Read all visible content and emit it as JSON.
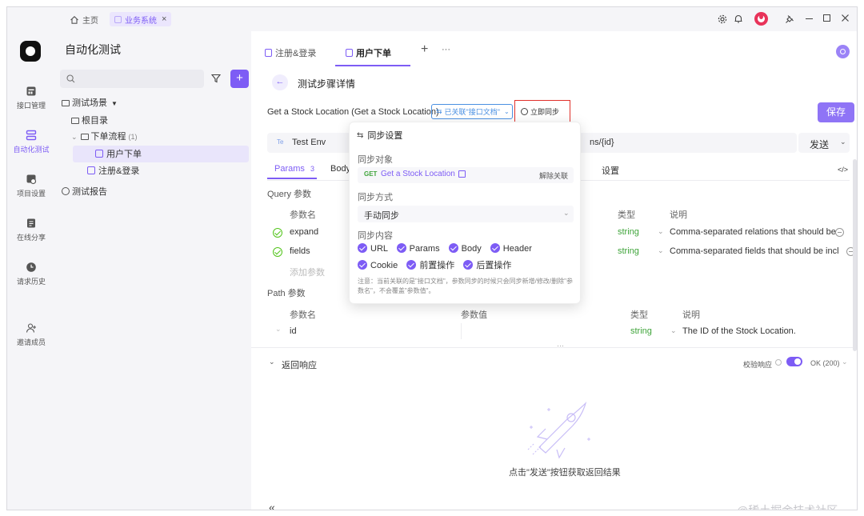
{
  "titlebar": {
    "home_tab": "主页",
    "biz_tab": "业务系统",
    "close": "×"
  },
  "rail": {
    "items": [
      {
        "label": "接口管理",
        "icon": "api-icon"
      },
      {
        "label": "自动化测试",
        "icon": "automation-icon",
        "active": true
      },
      {
        "label": "项目设置",
        "icon": "settings-icon"
      },
      {
        "label": "在线分享",
        "icon": "share-icon"
      },
      {
        "label": "请求历史",
        "icon": "history-icon"
      },
      {
        "label": "邀请成员",
        "icon": "invite-icon"
      }
    ]
  },
  "tree": {
    "title": "自动化测试",
    "search_placeholder": "",
    "add": "+",
    "scenes": "测试场景",
    "root_dir": "根目录",
    "folder": "下单流程",
    "folder_count": "(1)",
    "case_order": "用户下单",
    "case_login": "注册&登录",
    "report": "测试报告"
  },
  "tabs": {
    "tab1": "注册&登录",
    "tab2": "用户下单",
    "add": "+",
    "more": "···"
  },
  "detail": {
    "back": "←",
    "title": "测试步骤详情",
    "api_name": "Get a Stock Location (Get a Stock Location)",
    "linked_label": "已关联\"接口文档\"",
    "sync_now": "立即同步",
    "save": "保存",
    "env_badge": "Te",
    "env": "Test Env",
    "url_tail": "ns/{id}",
    "send": "发送"
  },
  "req_tabs": {
    "params": "Params",
    "params_count": "3",
    "body": "Body",
    "settings": "设置",
    "code": "</>"
  },
  "query": {
    "section": "Query 参数",
    "col_name": "参数名",
    "col_type": "类型",
    "col_desc": "说明",
    "rows": [
      {
        "name": "expand",
        "type": "string",
        "desc": "Comma-separated relations that should be"
      },
      {
        "name": "fields",
        "type": "string",
        "desc": "Comma-separated fields that should be incl"
      }
    ],
    "add_param": "添加参数"
  },
  "path": {
    "section": "Path 参数",
    "col_name": "参数名",
    "col_value": "参数值",
    "col_type": "类型",
    "col_desc": "说明",
    "rows": [
      {
        "name": "id",
        "type": "string",
        "desc": "The ID of the Stock Location."
      }
    ]
  },
  "response": {
    "title": "返回响应",
    "verify": "校验响应",
    "status": "OK (200)",
    "empty_hint": "点击\"发送\"按钮获取返回结果",
    "collapse": "«",
    "footer": "@稀土掘金技术社区"
  },
  "popup": {
    "title": "同步设置",
    "target_label": "同步对象",
    "method": "GET",
    "target": "Get a Stock Location",
    "unlink": "解除关联",
    "mode_label": "同步方式",
    "mode": "手动同步",
    "content_label": "同步内容",
    "options": [
      "URL",
      "Params",
      "Body",
      "Header",
      "Cookie",
      "前置操作",
      "后置操作"
    ],
    "note": "注意：当前关联的是\"接口文档\"，参数同步的时候只会同步新增/修改/删除\"参数名\"，不会覆盖\"参数值\"。"
  },
  "colors": {
    "accent": "#7d5cf5",
    "sidebar_bg": "#f5f5f8",
    "highlight": "#e0302b",
    "string_type": "#3fa43a"
  }
}
